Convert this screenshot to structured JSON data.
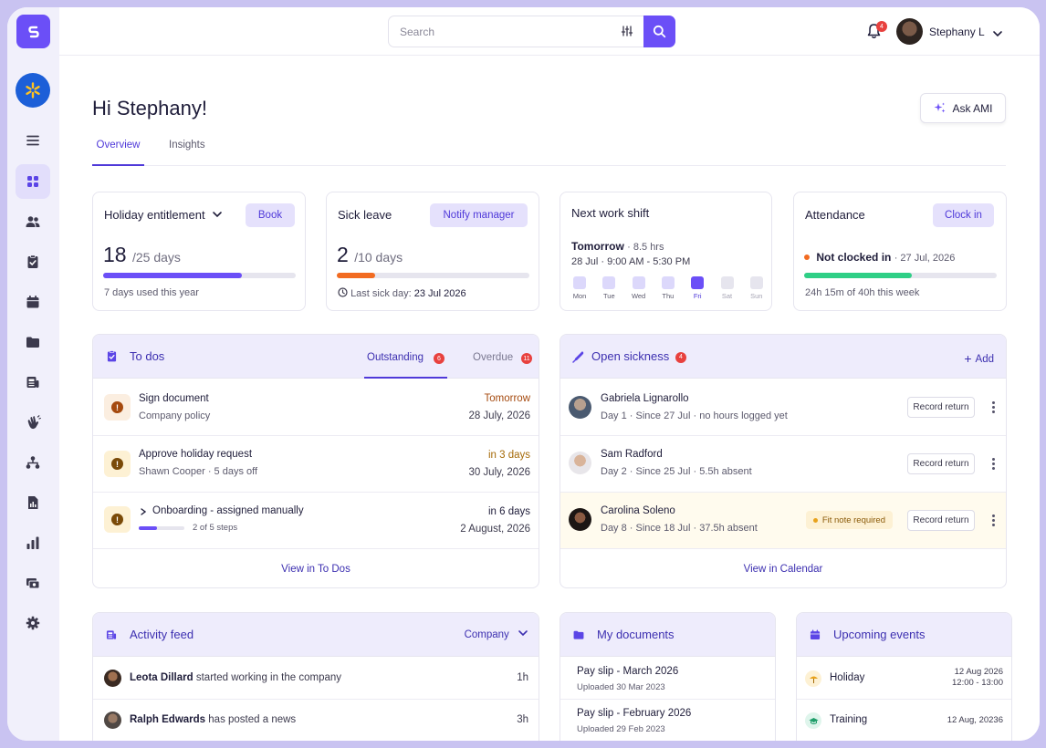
{
  "header": {
    "search_placeholder": "Search",
    "notification_count": "4",
    "user_name": "Stephany L"
  },
  "greeting": "Hi Stephany!",
  "ask_button": "Ask AMI",
  "tabs": [
    "Overview",
    "Insights"
  ],
  "holiday": {
    "title": "Holiday entitlement",
    "button": "Book",
    "value": "18",
    "unit": "/25 days",
    "progress": 0.72,
    "note": "7 days used this year"
  },
  "sick": {
    "title": "Sick leave",
    "button": "Notify manager",
    "value": "2",
    "unit": "/10 days",
    "progress": 0.2,
    "note_label": "Last sick day:",
    "note_date": "23 Jul 2026"
  },
  "shift": {
    "title": "Next work shift",
    "day": "Tomorrow",
    "hours": "· 8.5 hrs",
    "detail": "28 Jul · 9:00 AM - 5:30 PM",
    "days": [
      "Mon",
      "Tue",
      "Wed",
      "Thu",
      "Fri",
      "Sat",
      "Sun"
    ]
  },
  "attendance": {
    "title": "Attendance",
    "button": "Clock in",
    "status": "Not clocked in",
    "date": "· 27 Jul, 2026",
    "progress": 0.56,
    "note": "24h 15m of 40h this week"
  },
  "todos": {
    "title": "To dos",
    "tab_outstanding": "Outstanding",
    "outstanding_count": "6",
    "tab_overdue": "Overdue",
    "overdue_count": "11",
    "items": [
      {
        "title": "Sign document",
        "sub": "Company policy",
        "due": "Tomorrow",
        "date": "28 July, 2026"
      },
      {
        "title": "Approve holiday request",
        "sub": "Shawn Cooper · 5 days off",
        "due": "in 3 days",
        "date": "30 July, 2026"
      },
      {
        "title": "Onboarding - assigned manually",
        "sub": "2 of 5 steps",
        "due": "in 6 days",
        "date": "2 August, 2026",
        "progress": 0.4
      }
    ],
    "footer": "View in To Dos"
  },
  "sickness": {
    "title": "Open sickness",
    "count": "4",
    "add": "Add",
    "record_label": "Record return",
    "fit_note": "Fit note required",
    "people": [
      {
        "name": "Gabriela Lignarollo",
        "detail": "Day 1 · Since 27 Jul · no hours logged yet"
      },
      {
        "name": "Sam Radford",
        "detail": "Day 2 · Since 25 Jul · 5.5h absent"
      },
      {
        "name": "Carolina Soleno",
        "detail": "Day 8 · Since 18 Jul · 37.5h absent"
      }
    ],
    "footer": "View in Calendar"
  },
  "activity": {
    "title": "Activity feed",
    "filter": "Company",
    "items": [
      {
        "name": "Leota Dillard",
        "action": "started working in the company",
        "time": "1h"
      },
      {
        "name": "Ralph Edwards",
        "action": "has posted a news",
        "time": "3h"
      }
    ]
  },
  "documents": {
    "title": "My documents",
    "items": [
      {
        "name": "Pay slip - March 2026",
        "uploaded": "Uploaded 30 Mar 2023"
      },
      {
        "name": "Pay slip - February 2026",
        "uploaded": "Uploaded 29 Feb 2023"
      }
    ]
  },
  "events": {
    "title": "Upcoming events",
    "items": [
      {
        "name": "Holiday",
        "date": "12 Aug 2026",
        "time": "12:00 - 13:00"
      },
      {
        "name": "Training",
        "date": "12 Aug, 20236",
        "time": ""
      }
    ]
  },
  "colors": {
    "accent": "#6b4ff7",
    "sick_bar": "#f26b21",
    "attendance_bar": "#2fcf86",
    "status_dot": "#f26b21"
  }
}
